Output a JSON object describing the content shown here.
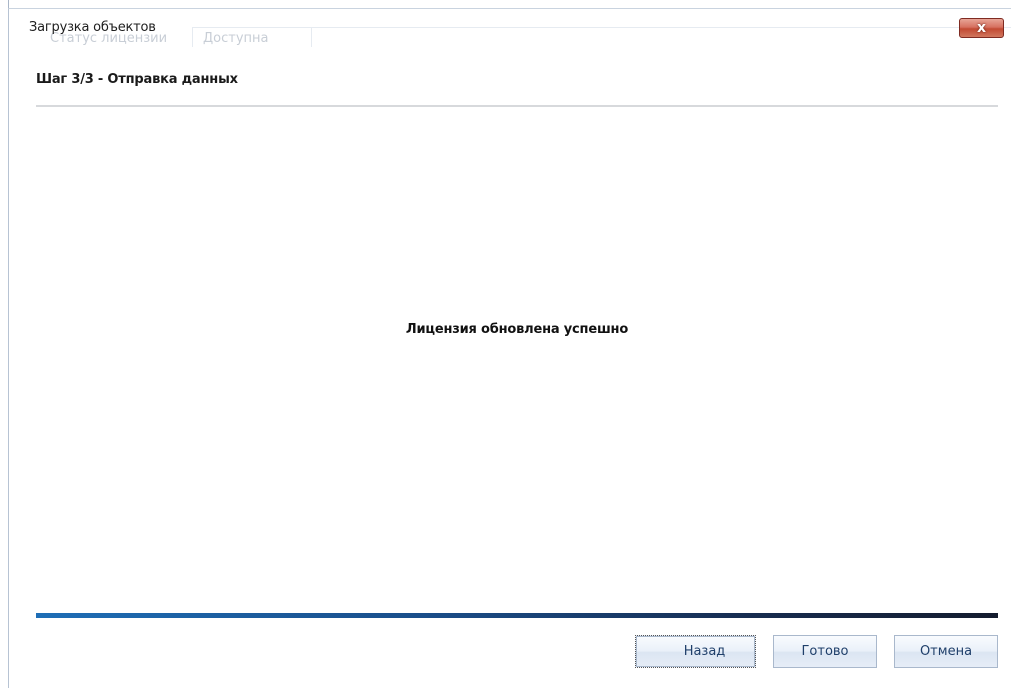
{
  "window": {
    "title": "Загрузка объектов",
    "close_glyph": "x"
  },
  "background": {
    "tabs": [
      "Статус лицензии",
      "Доступна"
    ]
  },
  "wizard": {
    "step_title": "Шаг 3/3 - Отправка данных",
    "message": "Лицензия обновлена успешно",
    "progress": 1.0
  },
  "buttons": {
    "back_label": "Назад",
    "done_label": "Готово",
    "cancel_label": "Отмена"
  },
  "colors": {
    "accent": "#1e6eb6",
    "close_button": "#c24a33",
    "button_text": "#1f3f6a"
  }
}
